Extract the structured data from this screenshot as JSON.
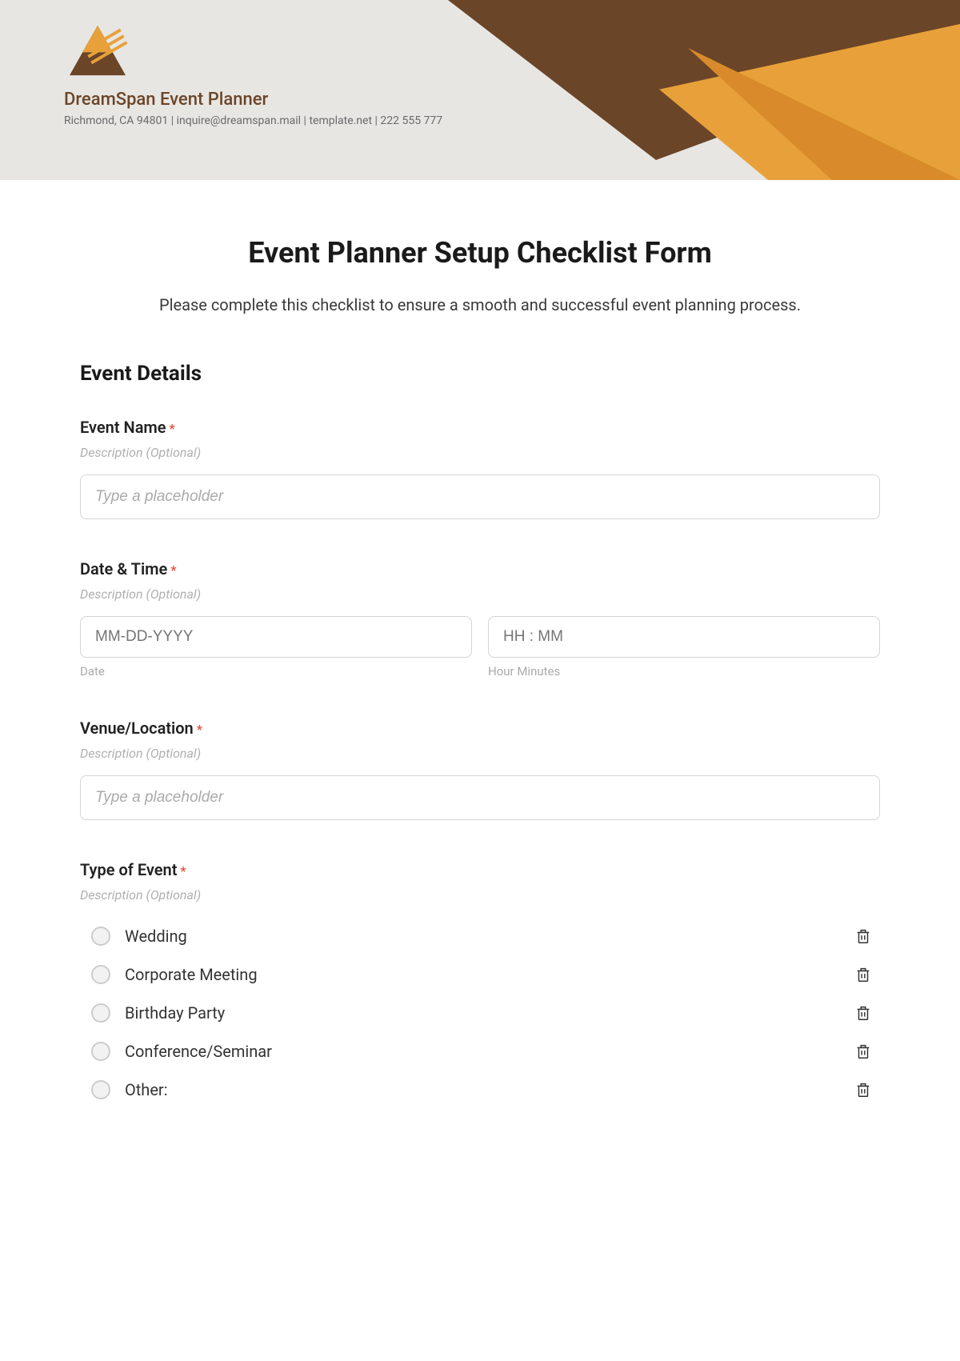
{
  "header": {
    "company_name": "DreamSpan Event Planner",
    "company_info": "Richmond, CA 94801 | inquire@dreamspan.mail | template.net | 222 555 777"
  },
  "form": {
    "title": "Event Planner Setup Checklist Form",
    "intro": "Please complete this checklist to ensure a smooth and successful event planning process.",
    "section_title": "Event Details",
    "required_mark": "*",
    "fields": {
      "event_name": {
        "label": "Event Name",
        "desc": "Description (Optional)",
        "placeholder": "Type a placeholder"
      },
      "date_time": {
        "label": "Date & Time",
        "desc": "Description (Optional)",
        "date_placeholder": "MM-DD-YYYY",
        "time_placeholder": "HH : MM",
        "date_sublabel": "Date",
        "time_sublabel": "Hour Minutes"
      },
      "venue": {
        "label": "Venue/Location",
        "desc": "Description (Optional)",
        "placeholder": "Type a placeholder"
      },
      "type_of_event": {
        "label": "Type of Event",
        "desc": "Description (Optional)",
        "options": [
          "Wedding",
          "Corporate Meeting",
          "Birthday Party",
          "Conference/Seminar",
          "Other:"
        ]
      }
    }
  }
}
